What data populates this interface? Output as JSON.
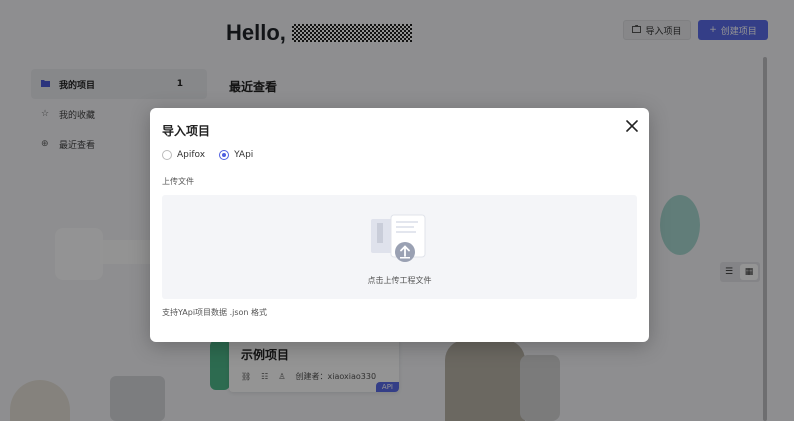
{
  "header": {
    "greeting": "Hello,",
    "import_button": "导入项目",
    "create_button": "创建项目"
  },
  "sidebar": {
    "items": [
      {
        "label": "我的项目",
        "count": "1",
        "icon": "folder-icon"
      },
      {
        "label": "我的收藏",
        "icon": "star-icon"
      },
      {
        "label": "最近查看",
        "icon": "recent-search-icon"
      }
    ]
  },
  "main": {
    "recent_title": "最近查看",
    "example_card": {
      "title": "示例项目",
      "creator": "创建者：xiaoxiao330",
      "tag": "API"
    }
  },
  "modal": {
    "title": "导入项目",
    "options": [
      {
        "label": "Apifox",
        "checked": false
      },
      {
        "label": "YApi",
        "checked": true
      }
    ],
    "upload_label": "上传文件",
    "dropzone_text": "点击上传工程文件",
    "hint": "支持YApi项目数据 .json 格式"
  },
  "colors": {
    "accent": "#5b6be8",
    "overlay": "#000000"
  }
}
